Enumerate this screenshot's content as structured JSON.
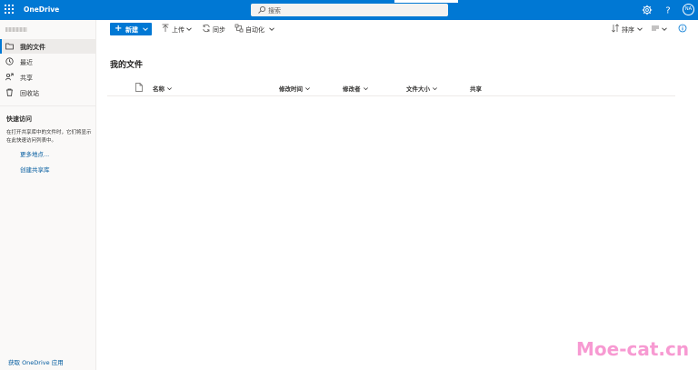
{
  "colors": {
    "suite_bar": "#0078d4",
    "nav_bg": "#faf9f8",
    "link": "#005a9e",
    "watermark": "#f79ad2"
  },
  "suite_bar": {
    "app_name": "OneDrive",
    "search_placeholder": "搜索",
    "avatar_initials": "NA",
    "icons": [
      "waffle-icon",
      "settings-icon",
      "help-icon"
    ]
  },
  "left_nav": {
    "items": [
      {
        "label": "我的文件",
        "icon": "folder-icon",
        "selected": true
      },
      {
        "label": "最近",
        "icon": "clock-icon",
        "selected": false
      },
      {
        "label": "共享",
        "icon": "share-icon",
        "selected": false
      },
      {
        "label": "回收站",
        "icon": "recycle-bin-icon",
        "selected": false
      }
    ],
    "quick_access": {
      "title": "快速访问",
      "description": "在打开共享库中的文件时，它们将显示在此快速访问列表中。",
      "more_places": "更多地点...",
      "create_library": "创建共享库"
    },
    "get_apps": "获取 OneDrive 应用"
  },
  "command_bar": {
    "new_label": "新建",
    "upload_label": "上传",
    "sync_label": "同步",
    "automate_label": "自动化",
    "sort_label": "排序"
  },
  "main": {
    "title": "我的文件",
    "columns": {
      "name": "名称",
      "modified": "修改时间",
      "modified_by": "修改者",
      "file_size": "文件大小",
      "sharing": "共享"
    }
  },
  "watermark": "Moe-cat.cn"
}
